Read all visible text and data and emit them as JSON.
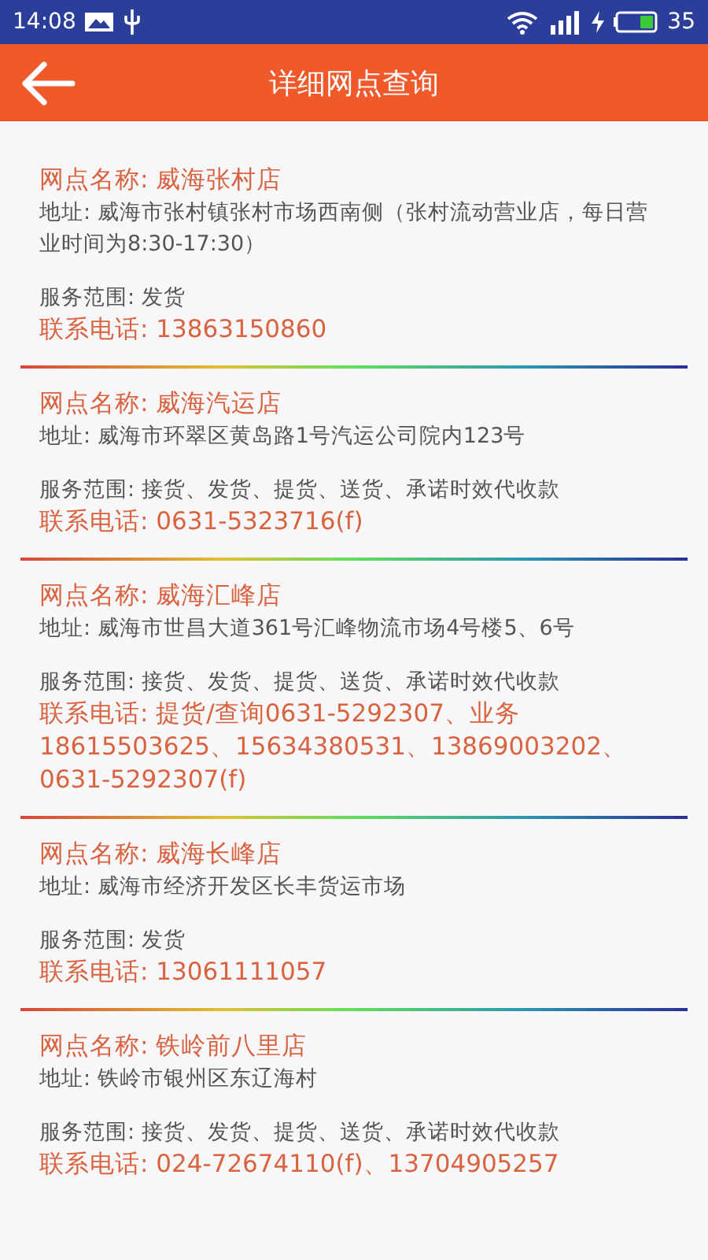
{
  "status_bar": {
    "time": "14:08",
    "battery_text": "35"
  },
  "header": {
    "title": "详细网点查询"
  },
  "outlets": [
    {
      "name": "网点名称: 威海张村店",
      "address": "地址: 威海市张村镇张村市场西南侧（张村流动营业店，每日营业时间为8:30-17:30）",
      "service": "服务范围: 发货",
      "phone": "联系电话: 13863150860"
    },
    {
      "name": "网点名称: 威海汽运店",
      "address": "地址: 威海市环翠区黄岛路1号汽运公司院内123号",
      "service": "服务范围: 接货、发货、提货、送货、承诺时效代收款",
      "phone": "联系电话: 0631-5323716(f)"
    },
    {
      "name": "网点名称: 威海汇峰店",
      "address": "地址: 威海市世昌大道361号汇峰物流市场4号楼5、6号",
      "service": "服务范围: 接货、发货、提货、送货、承诺时效代收款",
      "phone": "联系电话: 提货/查询0631-5292307、业务18615503625、15634380531、13869003202、0631-5292307(f)"
    },
    {
      "name": "网点名称: 威海长峰店",
      "address": "地址: 威海市经济开发区长丰货运市场",
      "service": "服务范围: 发货",
      "phone": "联系电话: 13061111057"
    },
    {
      "name": "网点名称: 铁岭前八里店",
      "address": "地址: 铁岭市银州区东辽海村",
      "service": "服务范围: 接货、发货、提货、送货、承诺时效代收款",
      "phone": "联系电话: 024-72674110(f)、13704905257"
    }
  ]
}
